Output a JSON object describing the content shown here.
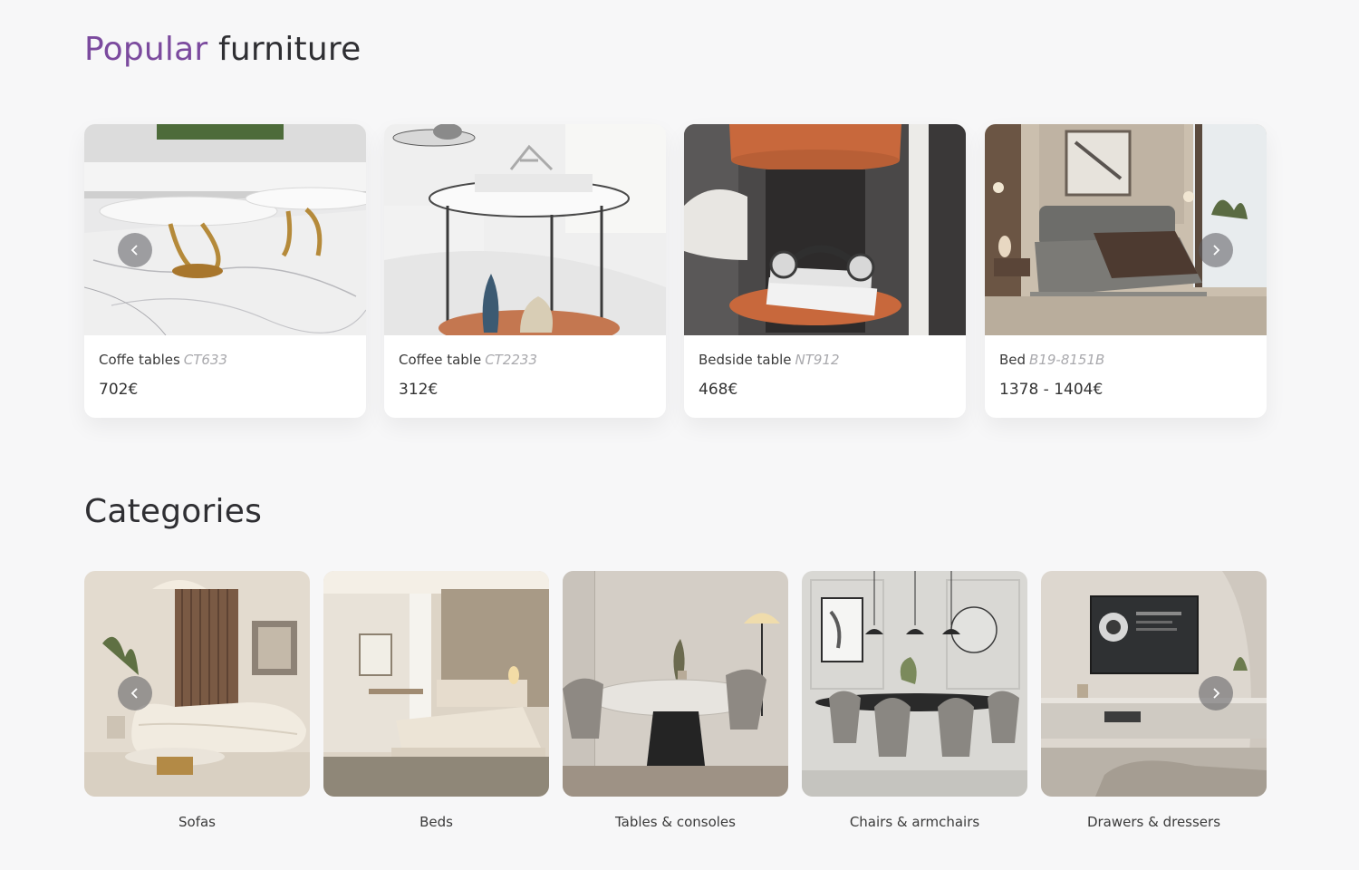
{
  "popular": {
    "title_accent": "Popular",
    "title_rest": "furniture",
    "products": [
      {
        "name": "Coffe tables",
        "code": "CT633",
        "price": "702€"
      },
      {
        "name": "Coffee table",
        "code": "CT2233",
        "price": "312€"
      },
      {
        "name": "Bedside table",
        "code": "NT912",
        "price": "468€"
      },
      {
        "name": "Bed",
        "code": "B19-8151B",
        "price": "1378 - 1404€"
      }
    ]
  },
  "categories": {
    "title": "Categories",
    "items": [
      {
        "label": "Sofas"
      },
      {
        "label": "Beds"
      },
      {
        "label": "Tables & consoles"
      },
      {
        "label": "Chairs & armchairs"
      },
      {
        "label": "Drawers & dressers"
      }
    ]
  },
  "icons": {
    "prev": "chevron-left-icon",
    "next": "chevron-right-icon"
  },
  "colors": {
    "accent": "#7b4a9e",
    "background": "#f7f7f8",
    "code_text": "#a9a9ad"
  }
}
